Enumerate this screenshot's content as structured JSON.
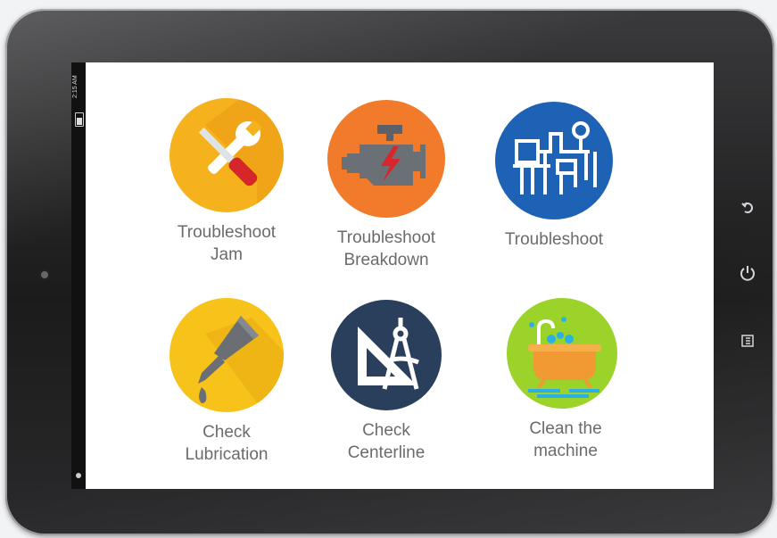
{
  "status": {
    "time": "2:15 AM"
  },
  "tiles": [
    {
      "label": "Troubleshoot\nJam",
      "color": "#f6b21d",
      "icon": "wrench-screwdriver-icon"
    },
    {
      "label": "Troubleshoot\nBreakdown",
      "color": "#f17a2b",
      "icon": "engine-icon"
    },
    {
      "label": "Troubleshoot",
      "color": "#1d62b4",
      "icon": "machine-icon"
    },
    {
      "label": "Check\nLubrication",
      "color": "#f7c31b",
      "icon": "oil-can-icon"
    },
    {
      "label": "Check\nCenterline",
      "color": "#2a3f5b",
      "icon": "compass-square-icon"
    },
    {
      "label": "Clean the\nmachine",
      "color": "#9bd32a",
      "icon": "bathtub-icon"
    }
  ],
  "nav": {
    "back": "back-icon",
    "power": "power-icon",
    "menu": "menu-icon"
  }
}
